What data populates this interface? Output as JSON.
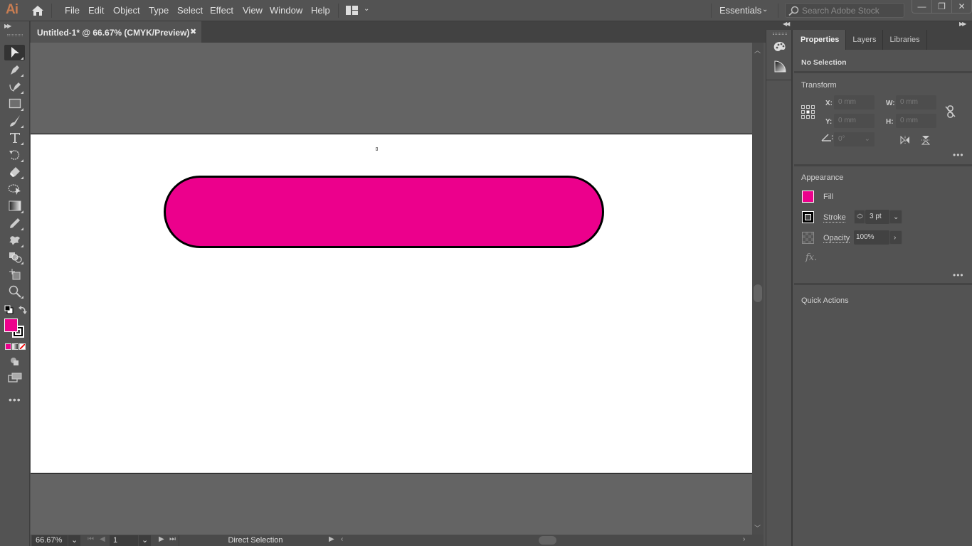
{
  "app": {
    "logo": "Ai"
  },
  "menu": {
    "items": [
      "File",
      "Edit",
      "Object",
      "Type",
      "Select",
      "Effect",
      "View",
      "Window",
      "Help"
    ],
    "workspace": "Essentials",
    "search_placeholder": "Search Adobe Stock"
  },
  "window_controls": {
    "minimize": "—",
    "restore": "❐",
    "close": "✕"
  },
  "document_tab": {
    "title": "Untitled-1* @ 66.67% (CMYK/Preview)",
    "close": "✖"
  },
  "tools": [
    "direct-selection",
    "pen",
    "curvature",
    "rectangle",
    "paintbrush",
    "type",
    "rotate",
    "eraser",
    "puppet-warp",
    "gradient",
    "eyedropper",
    "blend",
    "shape-builder",
    "artboard",
    "zoom"
  ],
  "colors": {
    "fill": "#ec008c",
    "stroke": "#000000",
    "accent_logo": "#c87d52"
  },
  "artwork": {
    "shape": "rounded-rectangle",
    "fill": "#ec008c",
    "stroke": "#000000"
  },
  "status_bar": {
    "zoom": "66.67%",
    "artboard_number": "1",
    "current_tool": "Direct Selection"
  },
  "panel": {
    "tabs": [
      "Properties",
      "Layers",
      "Libraries"
    ],
    "active_tab": "Properties",
    "selection": "No Selection",
    "transform": {
      "title": "Transform",
      "x_label": "X:",
      "x": "0 mm",
      "y_label": "Y:",
      "y": "0 mm",
      "w_label": "W:",
      "w": "0 mm",
      "h_label": "H:",
      "h": "0 mm",
      "angle": "0°"
    },
    "appearance": {
      "title": "Appearance",
      "fill_label": "Fill",
      "stroke_label": "Stroke",
      "stroke_weight": "3 pt",
      "opacity_label": "Opacity",
      "opacity": "100%",
      "fx": "fx."
    },
    "quick_actions": {
      "title": "Quick Actions"
    }
  }
}
